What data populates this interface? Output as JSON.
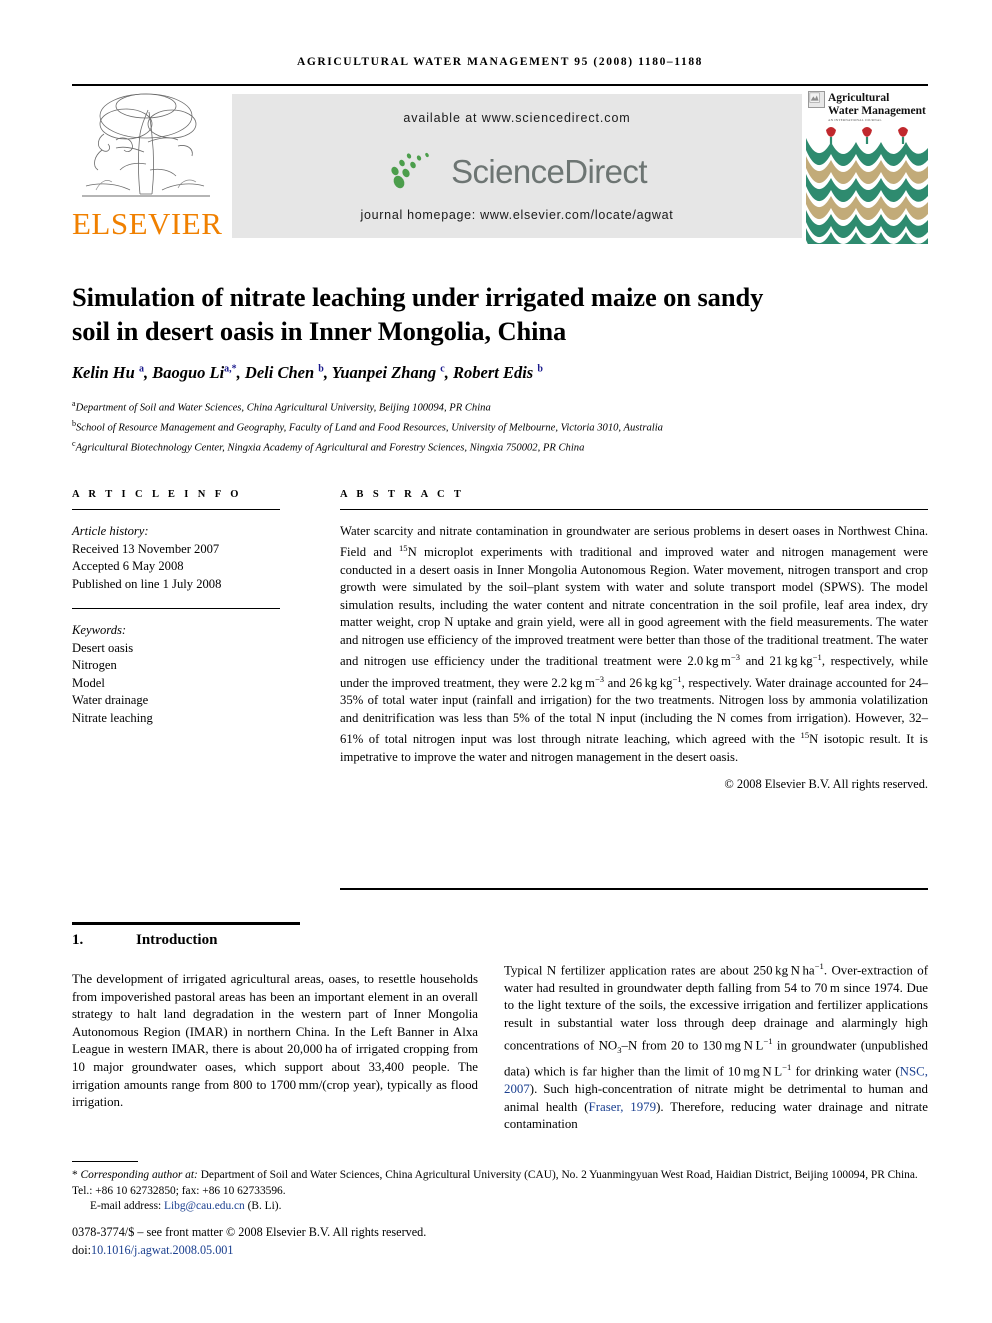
{
  "running_head": "AGRICULTURAL WATER MANAGEMENT 95 (2008) 1180–1188",
  "masthead": {
    "publisher_name": "ELSEVIER",
    "available_at": "available at www.sciencedirect.com",
    "sciencedirect_wordmark": "ScienceDirect",
    "journal_homepage": "journal homepage: www.elsevier.com/locate/agwat",
    "cover_title_line1": "Agricultural",
    "cover_title_line2": "Water Management",
    "cover_subtitle": "AN INTERNATIONAL JOURNAL",
    "elsevier_orange": "#f08000",
    "sciencedirect_grey": "#6d7573",
    "band_grey": "#e6e6e6",
    "cover_green": "#2e8b6f",
    "cover_tan": "#c2ab79",
    "cover_red": "#c0282d"
  },
  "article": {
    "title": "Simulation of nitrate leaching under irrigated maize on sandy soil in desert oasis in Inner Mongolia, China",
    "authors_html": "Kelin Hu <sup>a</sup>, Baoguo Li<sup>a,*</sup>, Deli Chen <sup>b</sup>, Yuanpei Zhang <sup>c</sup>, Robert Edis <sup>b</sup>",
    "affiliations": [
      {
        "marker": "a",
        "text": "Department of Soil and Water Sciences, China Agricultural University, Beijing 100094, PR China"
      },
      {
        "marker": "b",
        "text": "School of Resource Management and Geography, Faculty of Land and Food Resources, University of Melbourne, Victoria 3010, Australia"
      },
      {
        "marker": "c",
        "text": "Agricultural Biotechnology Center, Ningxia Academy of Agricultural and Forestry Sciences, Ningxia 750002, PR China"
      }
    ]
  },
  "article_info": {
    "heading": "A R T I C L E   I N F O",
    "history_label": "Article history:",
    "history": [
      "Received 13 November 2007",
      "Accepted 6 May 2008",
      "Published on line 1 July 2008"
    ],
    "keywords_label": "Keywords:",
    "keywords": [
      "Desert oasis",
      "Nitrogen",
      "Model",
      "Water drainage",
      "Nitrate leaching"
    ]
  },
  "abstract": {
    "heading": "A B S T R A C T",
    "text_html": "Water scarcity and nitrate contamination in groundwater are serious problems in desert oases in Northwest China. Field and <sup>15</sup>N microplot experiments with traditional and improved water and nitrogen management were conducted in a desert oasis in Inner Mongolia Autonomous Region. Water movement, nitrogen transport and crop growth were simulated by the soil&ndash;plant system with water and solute transport model (SPWS). The model simulation results, including the water content and nitrate concentration in the soil profile, leaf area index, dry matter weight, crop N uptake and grain yield, were all in good agreement with the field measurements. The water and nitrogen use efficiency of the improved treatment were better than those of the traditional treatment. The water and nitrogen use efficiency under the traditional treatment were 2.0&thinsp;kg&thinsp;m<sup>&minus;3</sup> and 21&thinsp;kg&thinsp;kg<sup>&minus;1</sup>, respectively, while under the improved treatment, they were 2.2&thinsp;kg&thinsp;m<sup>&minus;3</sup> and 26&thinsp;kg&thinsp;kg<sup>&minus;1</sup>, respectively. Water drainage accounted for 24&ndash;35% of total water input (rainfall and irrigation) for the two treatments. Nitrogen loss by ammonia volatilization and denitrification was less than 5% of the total N input (including the N comes from irrigation). However, 32&ndash;61% of total nitrogen input was lost through nitrate leaching, which agreed with the <sup>15</sup>N isotopic result. It is impetrative to improve the water and nitrogen management in the desert oasis.",
    "copyright": "© 2008 Elsevier B.V. All rights reserved."
  },
  "section": {
    "number": "1.",
    "title": "Introduction",
    "left_column_html": "The development of irrigated agricultural areas, oases, to resettle households from impoverished pastoral areas has been an important element in an overall strategy to halt land degradation in the western part of Inner Mongolia Autonomous Region (IMAR) in northern China. In the Left Banner in Alxa League in western IMAR, there is about 20,000&thinsp;ha of irrigated cropping from 10 major groundwater oases, which support about 33,400 people. The irrigation amounts range from 800 to 1700&thinsp;mm/(crop year), typically as flood irrigation.",
    "right_column_html": "Typical N fertilizer application rates are about 250&thinsp;kg&thinsp;N&thinsp;ha<sup>&minus;1</sup>. Over-extraction of water had resulted in groundwater depth falling from 54 to 70&thinsp;m since 1974. Due to the light texture of the soils, the excessive irrigation and fertilizer applications result in substantial water loss through deep drainage and alarmingly high concentrations of NO<sub>3</sub>&ndash;N from 20 to 130&thinsp;mg&thinsp;N&thinsp;L<sup>&minus;1</sup> in groundwater (unpublished data) which is far higher than the limit of 10&thinsp;mg&thinsp;N&thinsp;L<sup>&minus;1</sup> for drinking water (<span class=\"cite\">NSC, 2007</span>). Such high-concentration of nitrate might be detrimental to human and animal health (<span class=\"cite\">Fraser, 1979</span>). Therefore, reducing water drainage and nitrate contamination"
  },
  "footnotes": {
    "corresponding_html": "* <span class=\"it\">Corresponding author at:</span> Department of Soil and Water Sciences, China Agricultural University (CAU), No. 2 Yuanmingyuan West Road, Haidian District, Beijing 100094, PR China. Tel.: +86 10 62732850; fax: +86 10 62733596.",
    "email_html": "E-mail address: <span class=\"link\">Libg@cau.edu.cn</span> (B. Li).",
    "issn_line": "0378-3774/$ – see front matter © 2008 Elsevier B.V. All rights reserved.",
    "doi_prefix": "doi:",
    "doi_value": "10.1016/j.agwat.2008.05.001"
  }
}
